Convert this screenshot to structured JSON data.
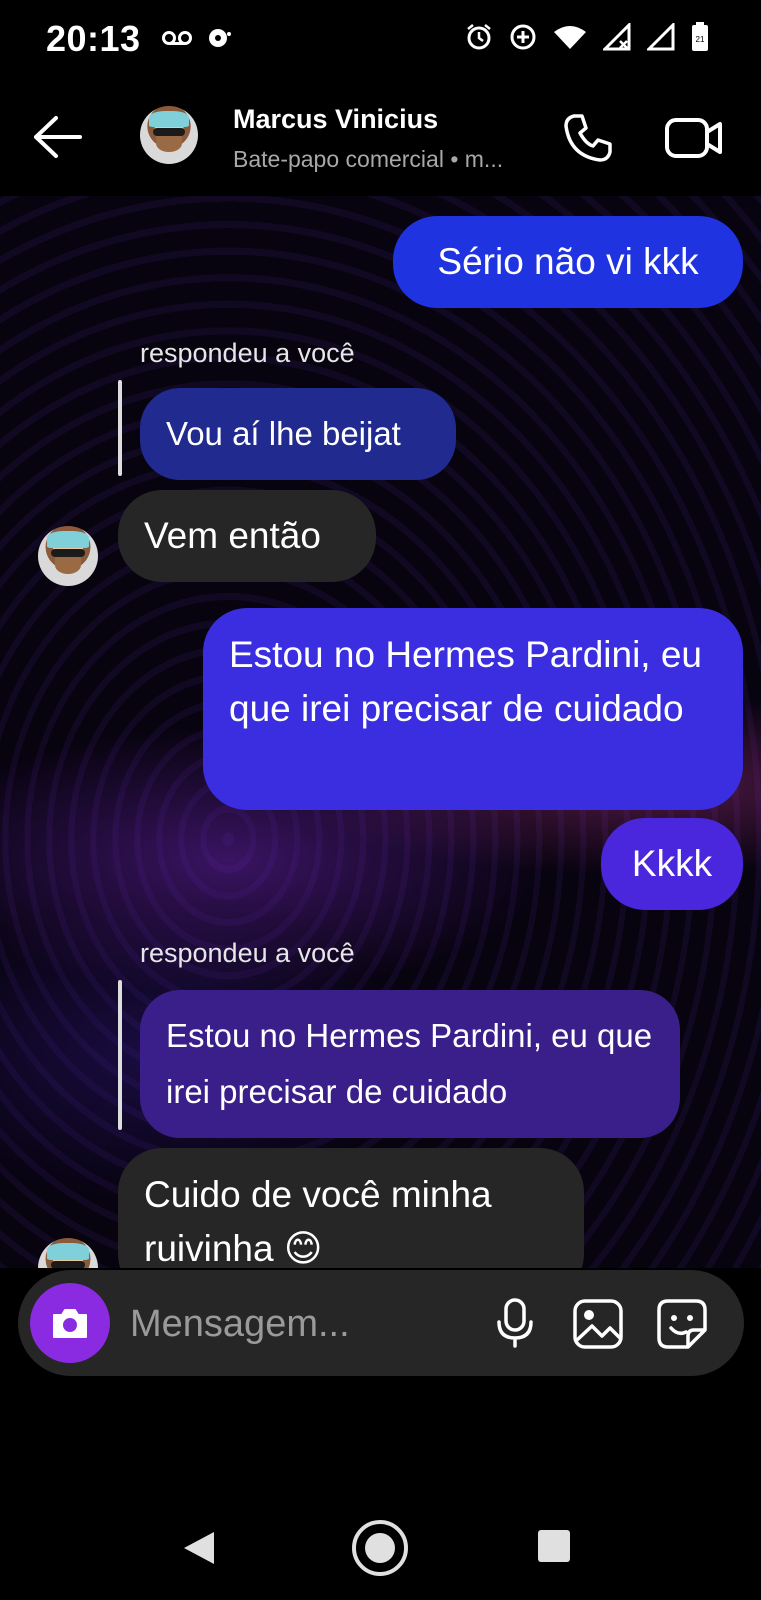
{
  "status_bar": {
    "time": "20:13",
    "left_icons": [
      "voicemail-icon",
      "headphones-notification-icon"
    ],
    "right_icons": [
      "alarm-icon",
      "data-saver-icon",
      "wifi-icon",
      "signal-no-data-icon",
      "signal-icon",
      "battery-icon"
    ],
    "battery_level": "21"
  },
  "header": {
    "contact_name": "Marcus Vinicius",
    "subtitle": "Bate-papo comercial • m..."
  },
  "messages": [
    {
      "id": "m1",
      "direction": "out",
      "text": "Sério não vi kkk"
    },
    {
      "id": "m2",
      "direction": "in",
      "reply_label": "respondeu a você",
      "quoted_text": "Vou aí lhe beijat",
      "text": "Vem então"
    },
    {
      "id": "m3",
      "direction": "out",
      "text": "Estou no Hermes Pardini, eu que irei precisar de cuidado"
    },
    {
      "id": "m4",
      "direction": "out",
      "text": "Kkkk"
    },
    {
      "id": "m5",
      "direction": "in",
      "reply_label": "respondeu a você",
      "quoted_text": "Estou no Hermes Pardini, eu que irei precisar de cuidado",
      "text": "Cuido de você minha ruivinha 😊"
    }
  ],
  "composer": {
    "placeholder": "Mensagem..."
  },
  "colors": {
    "outgoing_blue": "#1f33e0",
    "outgoing_violet": "#4a27dc",
    "incoming": "#262626",
    "camera_button": "#8a2be2"
  }
}
